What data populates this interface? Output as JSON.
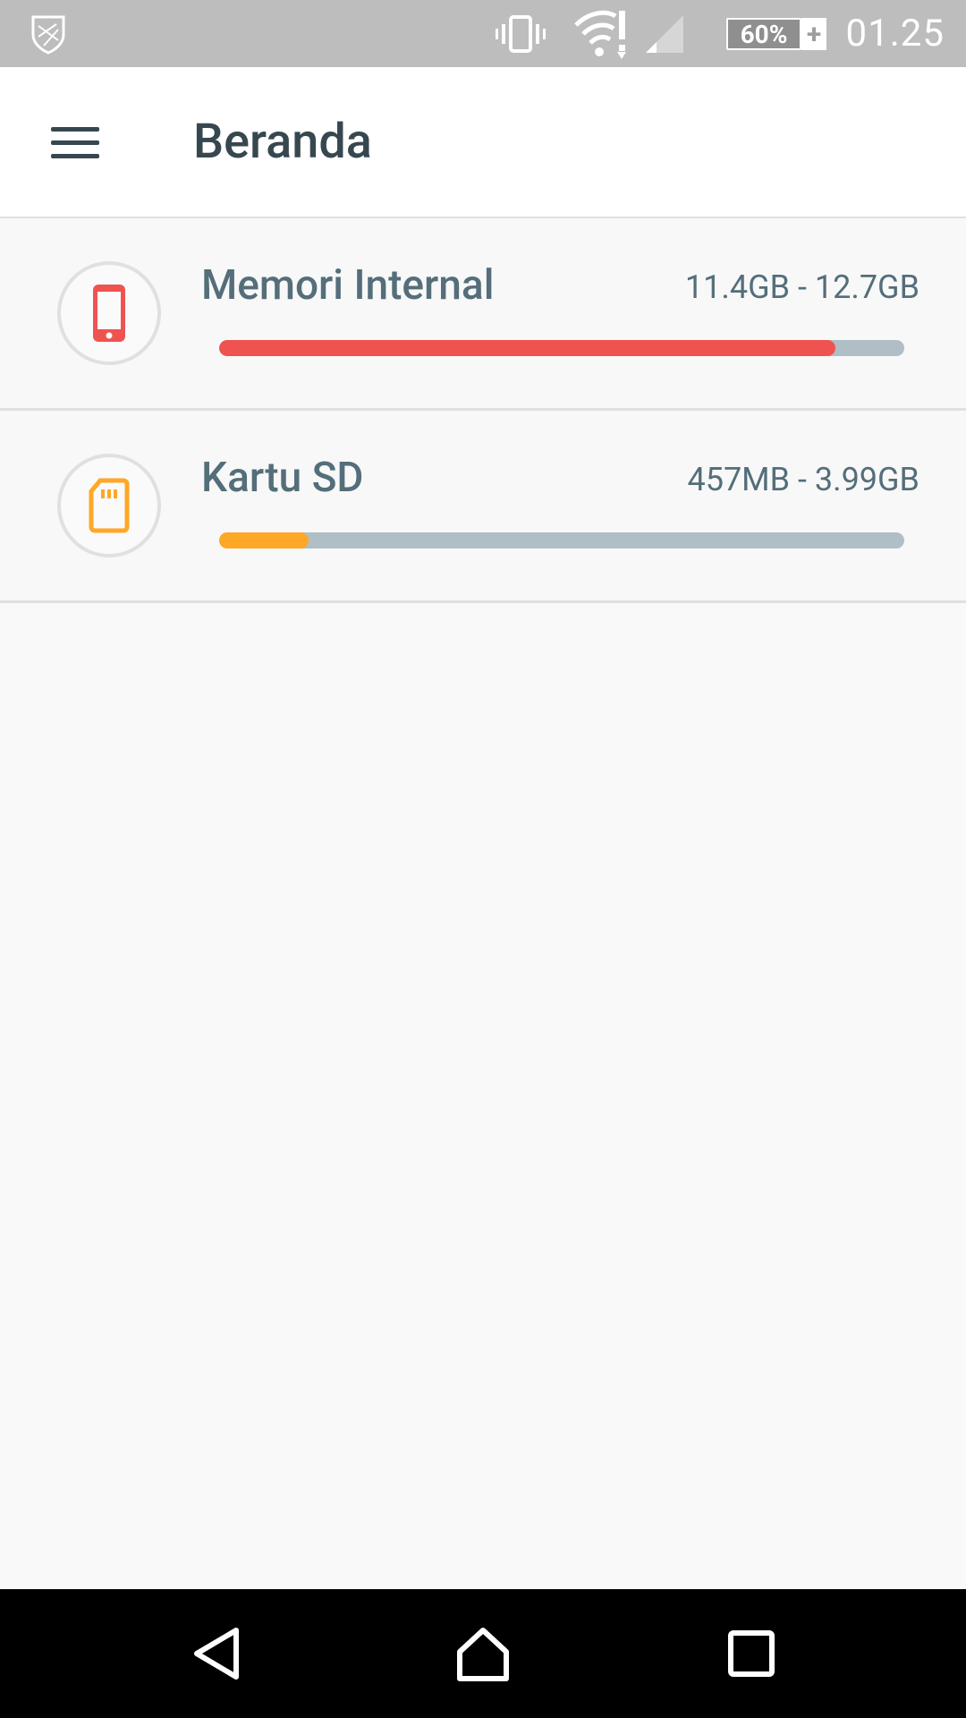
{
  "status_bar": {
    "time": "01.25",
    "battery_percent": "60%",
    "icons": [
      "shield-icon",
      "vibrate-icon",
      "wifi-alert-icon",
      "signal-icon",
      "battery-charging-icon"
    ]
  },
  "app_bar": {
    "title": "Beranda",
    "menu_icon": "hamburger-menu-icon"
  },
  "storage": [
    {
      "name": "Memori Internal",
      "size": "11.4GB - 12.7GB",
      "used_fraction": 0.9,
      "color": "#ef5350",
      "icon": "phone-icon"
    },
    {
      "name": "Kartu SD",
      "size": "457MB - 3.99GB",
      "used_fraction": 0.13,
      "color": "#ffa726",
      "icon": "sd-card-icon"
    }
  ],
  "nav_bar": {
    "buttons": [
      "back-icon",
      "home-icon",
      "recents-icon"
    ]
  }
}
